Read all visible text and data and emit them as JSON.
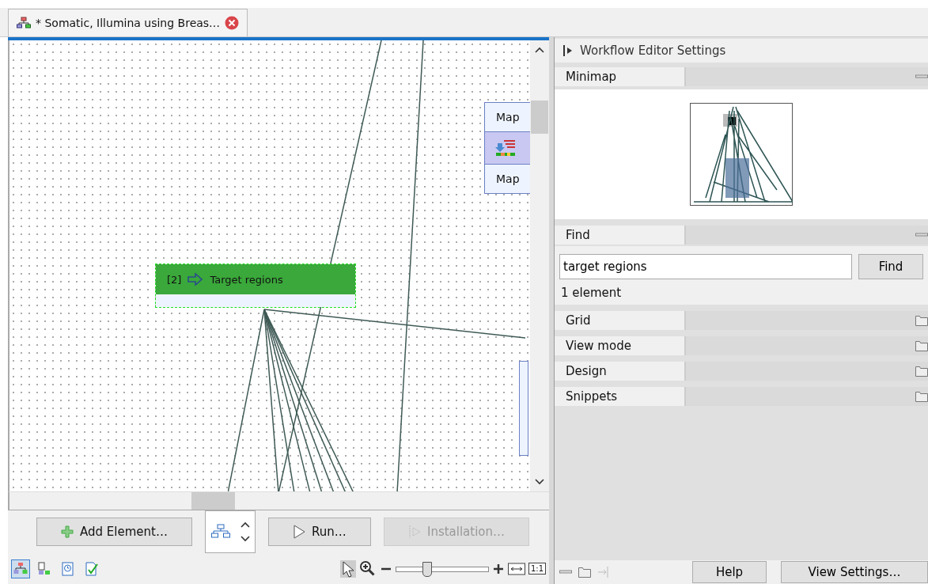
{
  "tab": {
    "title": "* Somatic, Illumina using Breas…",
    "selected": true
  },
  "canvas": {
    "nodes": [
      {
        "kind": "partial",
        "top_label": "Map",
        "bottom_label": "Map",
        "selected": false
      },
      {
        "kind": "element",
        "index": "[2]",
        "label": "Target regions",
        "selected": true
      }
    ]
  },
  "settings": {
    "title": "Workflow Editor Settings",
    "sections": [
      {
        "kind": "minimap",
        "title": "Minimap",
        "expanded": true
      },
      {
        "kind": "find",
        "title": "Find",
        "expanded": true,
        "value": "target regions",
        "button": "Find",
        "result": "1 element"
      },
      {
        "title": "Grid",
        "expanded": false
      },
      {
        "title": "View mode",
        "expanded": false
      },
      {
        "title": "Design",
        "expanded": false
      },
      {
        "title": "Snippets",
        "expanded": false
      }
    ],
    "buttons": [
      "Help",
      "View Settings…"
    ]
  },
  "toolbar": {
    "buttons": [
      {
        "label": "Add Element…",
        "disabled": false,
        "kind": "add"
      },
      {
        "label": "Run…",
        "disabled": false,
        "kind": "run"
      },
      {
        "label": "Installation…",
        "disabled": true,
        "kind": "install"
      }
    ],
    "views": [
      {
        "selected": true
      },
      {
        "selected": false
      },
      {
        "selected": false
      },
      {
        "selected": false
      }
    ],
    "pointer_selected": true,
    "zoom": {
      "level": 0.33
    },
    "one_to_one": "1:1"
  }
}
